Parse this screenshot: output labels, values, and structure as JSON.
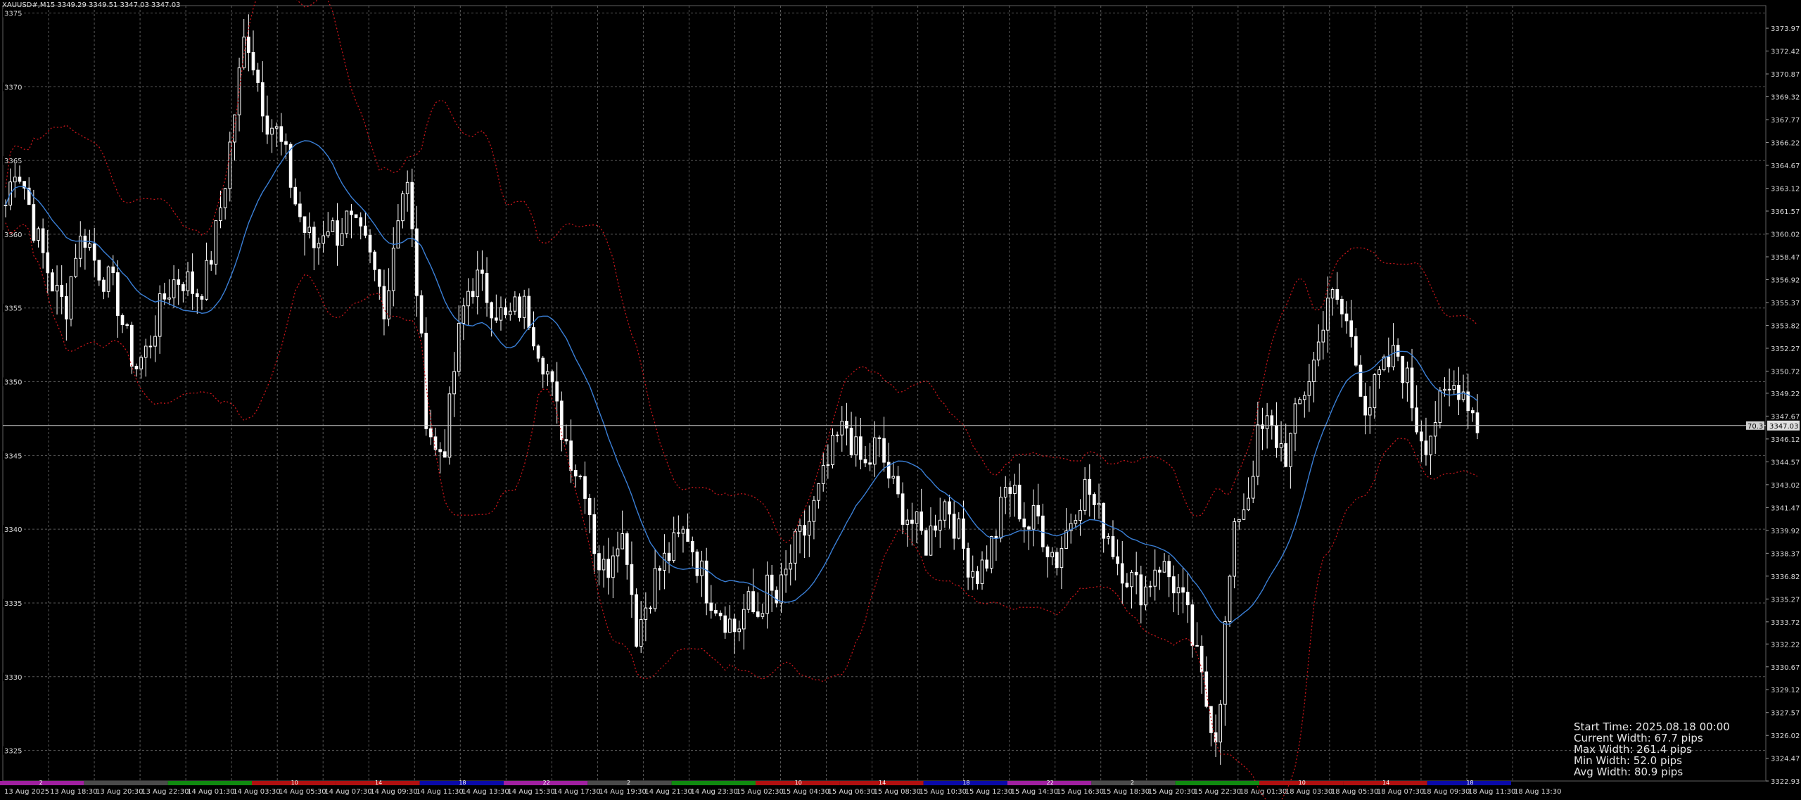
{
  "header": {
    "title": "XAUUSD#,M15  3349.29 3349.51 3347.03 3347.03"
  },
  "colors": {
    "background": "#000000",
    "grid": "#5a5a5a",
    "candle": "#ffffff",
    "ma": "#3a7fd6",
    "bands": "#c8161b",
    "hline": "#c8c8c8",
    "magenta": "#a020a0",
    "red": "#b01010",
    "blue": "#0a0aa8",
    "green": "#108a10",
    "gray": "#4a4a4a"
  },
  "chart_data": {
    "type": "candlestick",
    "title": "XAUUSD#,M15  3349.29 3349.51 3347.03 3347.03",
    "ylim": [
      3322.93,
      3375.5
    ],
    "grid": true,
    "current_price": "3347.03",
    "price_marker": "70.3",
    "y_ticks_right": [
      "3373.97",
      "3372.42",
      "3370.87",
      "3369.32",
      "3367.77",
      "3366.22",
      "3364.67",
      "3363.12",
      "3361.57",
      "3360.02",
      "3358.47",
      "3356.92",
      "3355.37",
      "3353.82",
      "3352.27",
      "3350.72",
      "3349.22",
      "3347.67",
      "3346.12",
      "3344.57",
      "3343.02",
      "3341.47",
      "3339.92",
      "3338.37",
      "3336.82",
      "3335.27",
      "3333.72",
      "3332.22",
      "3330.67",
      "3329.12",
      "3327.57",
      "3326.02",
      "3324.47",
      "3322.93"
    ],
    "y_ticks_left": [
      "3375",
      "3370",
      "3365",
      "3360",
      "3355",
      "3350",
      "3345",
      "3340",
      "3335",
      "3330",
      "3325"
    ],
    "x_ticks": [
      "13 Aug 2025",
      "13 Aug 18:30",
      "13 Aug 20:30",
      "13 Aug 22:30",
      "14 Aug 01:30",
      "14 Aug 03:30",
      "14 Aug 05:30",
      "14 Aug 07:30",
      "14 Aug 09:30",
      "14 Aug 11:30",
      "14 Aug 13:30",
      "14 Aug 15:30",
      "14 Aug 17:30",
      "14 Aug 19:30",
      "14 Aug 21:30",
      "14 Aug 23:30",
      "15 Aug 02:30",
      "15 Aug 04:30",
      "15 Aug 06:30",
      "15 Aug 08:30",
      "15 Aug 10:30",
      "15 Aug 12:30",
      "15 Aug 14:30",
      "15 Aug 16:30",
      "15 Aug 18:30",
      "15 Aug 20:30",
      "15 Aug 22:30",
      "18 Aug 01:30",
      "18 Aug 03:30",
      "18 Aug 05:30",
      "18 Aug 07:30",
      "18 Aug 09:30",
      "18 Aug 11:30",
      "18 Aug 13:30"
    ],
    "close_path": [
      3362,
      3365,
      3363,
      3360,
      3358,
      3356,
      3355,
      3359,
      3360,
      3358,
      3357,
      3356,
      3353,
      3351,
      3352,
      3354,
      3356,
      3357,
      3357,
      3356,
      3357,
      3360,
      3364,
      3369,
      3374,
      3371,
      3368,
      3367,
      3365,
      3362,
      3360,
      3359,
      3361,
      3360,
      3361,
      3360,
      3359,
      3357,
      3355,
      3361,
      3364,
      3357,
      3348,
      3345,
      3346,
      3352,
      3356,
      3357,
      3356,
      3355,
      3354,
      3355,
      3355,
      3353,
      3351,
      3348,
      3346,
      3344,
      3343,
      3338,
      3337,
      3340,
      3339,
      3333,
      3335,
      3337,
      3338,
      3339,
      3340,
      3338,
      3336,
      3335,
      3334,
      3333,
      3335,
      3334,
      3336,
      3335,
      3337,
      3339,
      3340,
      3342,
      3344,
      3346,
      3347,
      3345,
      3344,
      3346,
      3344,
      3342,
      3341,
      3340,
      3339,
      3341,
      3342,
      3340,
      3338,
      3337,
      3338,
      3340,
      3343,
      3342,
      3340,
      3341,
      3339,
      3338,
      3340,
      3342,
      3343,
      3341,
      3340,
      3338,
      3337,
      3336,
      3336,
      3338,
      3337,
      3336,
      3334,
      3331,
      3328,
      3326,
      3335,
      3341,
      3342,
      3346,
      3347,
      3346,
      3345,
      3348,
      3350,
      3352,
      3356,
      3355,
      3354,
      3351,
      3348,
      3350,
      3351,
      3352,
      3350,
      3347,
      3346,
      3348,
      3349,
      3350,
      3349,
      3347
    ],
    "indicator": {
      "start_time_label": "Start Time: 2025.08.18 00:00",
      "current_width_label": "Current Width: 67.7 pips",
      "max_width_label": "Max Width: 261.4 pips",
      "min_width_label": "Min Width: 52.0 pips",
      "avg_width_label": "Avg Width: 80.9 pips"
    },
    "session_bar": [
      {
        "color": "magenta",
        "label": "2"
      },
      {
        "color": "gray",
        "label": ""
      },
      {
        "color": "green",
        "label": ""
      },
      {
        "color": "red",
        "label": "10"
      },
      {
        "color": "red",
        "label": "14"
      },
      {
        "color": "blue",
        "label": "18"
      },
      {
        "color": "magenta",
        "label": "22"
      },
      {
        "color": "gray",
        "label": "2"
      },
      {
        "color": "green",
        "label": ""
      },
      {
        "color": "red",
        "label": "10"
      },
      {
        "color": "red",
        "label": "14"
      },
      {
        "color": "blue",
        "label": "18"
      },
      {
        "color": "magenta",
        "label": "22"
      },
      {
        "color": "gray",
        "label": "2"
      },
      {
        "color": "green",
        "label": ""
      },
      {
        "color": "red",
        "label": "10"
      },
      {
        "color": "red",
        "label": "14"
      },
      {
        "color": "blue",
        "label": "18"
      }
    ]
  }
}
